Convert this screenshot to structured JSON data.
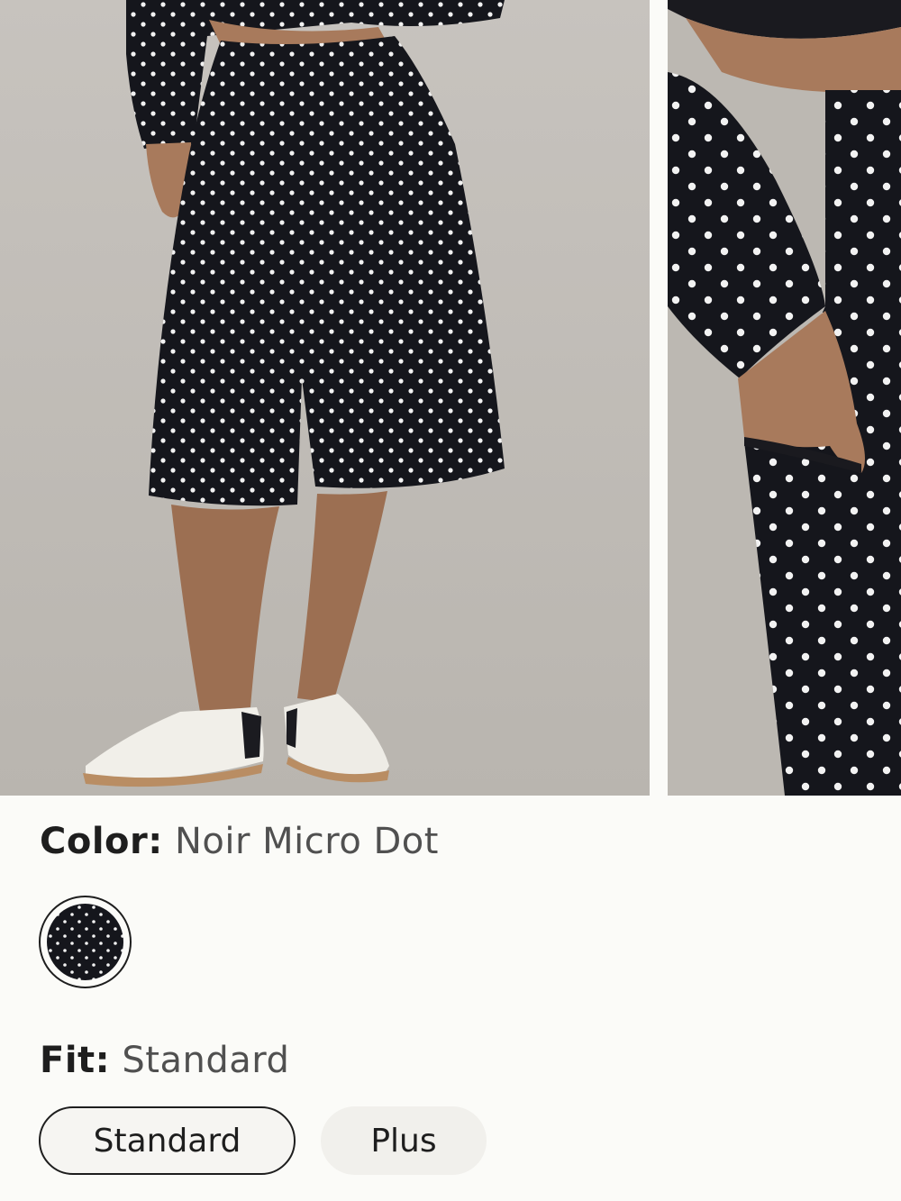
{
  "gallery": {
    "images": [
      {
        "name": "model wearing polka dot shorts, full view"
      },
      {
        "name": "detail view of pocket with hand"
      }
    ]
  },
  "color": {
    "label": "Color:",
    "value": "Noir Micro Dot",
    "swatches": [
      {
        "name": "Noir Micro Dot",
        "hex": "#15161c",
        "selected": true
      }
    ]
  },
  "fit": {
    "label": "Fit:",
    "value": "Standard",
    "options": [
      {
        "label": "Standard",
        "selected": true
      },
      {
        "label": "Plus",
        "selected": false
      }
    ]
  },
  "colors": {
    "background": "#fbfbf8",
    "text": "#1e1e1e",
    "muted_text": "#505050",
    "garment": "#15161c",
    "dot": "#f2f2f2"
  }
}
